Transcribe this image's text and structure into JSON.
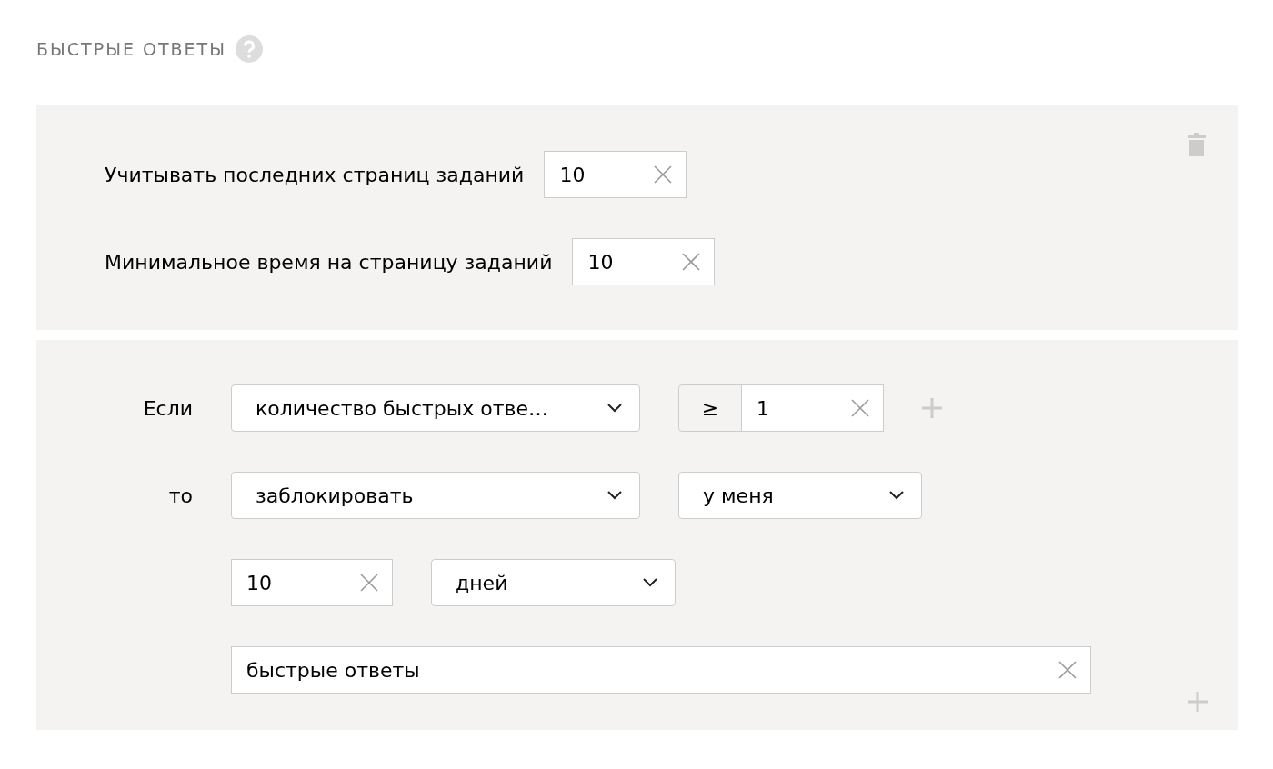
{
  "heading": {
    "title": "БЫСТРЫЕ ОТВЕТЫ"
  },
  "settings": [
    {
      "label": "Учитывать последних страниц заданий",
      "value": "10"
    },
    {
      "label": "Минимальное время на страницу заданий",
      "value": "10"
    }
  ],
  "rule": {
    "if_label": "Если",
    "metric": "количество быстрых отве…",
    "operator": "≥",
    "threshold": "1",
    "then_label": "то",
    "action": "заблокировать",
    "scope": "у меня",
    "duration": "10",
    "unit": "дней",
    "reason": "быстрые ответы"
  }
}
